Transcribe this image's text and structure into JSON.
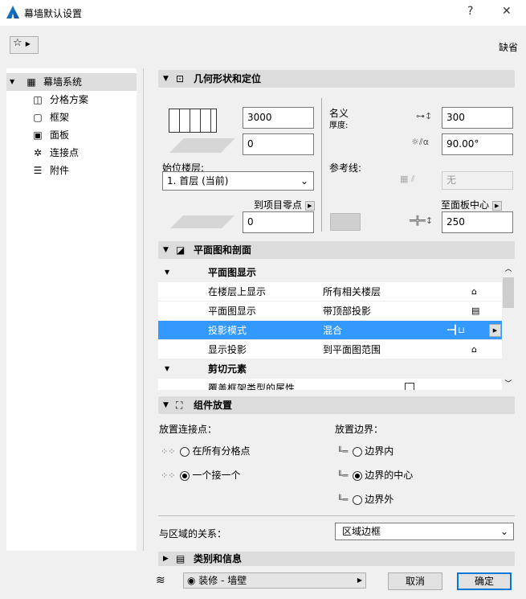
{
  "window": {
    "title": "幕墙默认设置",
    "help": "?",
    "close": "✕"
  },
  "header": {
    "favorites": "☆",
    "default_label": "缺省"
  },
  "sidebar": {
    "items": [
      {
        "label": "幕墙系统",
        "icon": "curtain-wall-icon"
      },
      {
        "label": "分格方案",
        "icon": "grid-scheme-icon"
      },
      {
        "label": "框架",
        "icon": "frame-icon"
      },
      {
        "label": "面板",
        "icon": "panel-icon"
      },
      {
        "label": "连接点",
        "icon": "junction-icon"
      },
      {
        "label": "附件",
        "icon": "accessory-icon"
      }
    ]
  },
  "geometry": {
    "title": "几何形状和定位",
    "height": "3000",
    "offset": "0",
    "home_story_label": "始位楼层:",
    "home_story": "1. 首层 (当前)",
    "to_project_zero": "到项目零点",
    "project_zero_value": "0",
    "nominal_thickness_label": "名义",
    "thickness_sub": "厚度:",
    "thickness": "300",
    "angle": "90.00°",
    "reference_line_label": "参考线:",
    "reference_line_value": "无",
    "to_panel_center": "至面板中心",
    "panel_offset": "250"
  },
  "plan": {
    "title": "平面图和剖面",
    "groups": [
      {
        "label": "平面图显示",
        "rows": [
          {
            "name": "在楼层上显示",
            "value": "所有相关楼层"
          },
          {
            "name": "平面图显示",
            "value": "带顶部投影"
          },
          {
            "name": "投影模式",
            "value": "混合",
            "selected": true
          },
          {
            "name": "显示投影",
            "value": "到平面图范围"
          }
        ]
      },
      {
        "label": "剪切元素",
        "rows": [
          {
            "name": "覆盖框架类型的属性",
            "value": ""
          }
        ]
      }
    ]
  },
  "placement": {
    "title": "组件放置",
    "junctions_label": "放置连接点：",
    "junction_options": [
      "在所有分格点",
      "一个接一个"
    ],
    "junction_selected": 1,
    "boundary_label": "放置边界：",
    "boundary_options": [
      "边界内",
      "边界的中心",
      "边界外"
    ],
    "boundary_selected": 1,
    "zone_relation_label": "与区域的关系：",
    "zone_relation_value": "区域边框"
  },
  "classification": {
    "title": "类别和信息"
  },
  "footer": {
    "layer": "装修 - 墙壁",
    "cancel": "取消",
    "ok": "确定"
  }
}
